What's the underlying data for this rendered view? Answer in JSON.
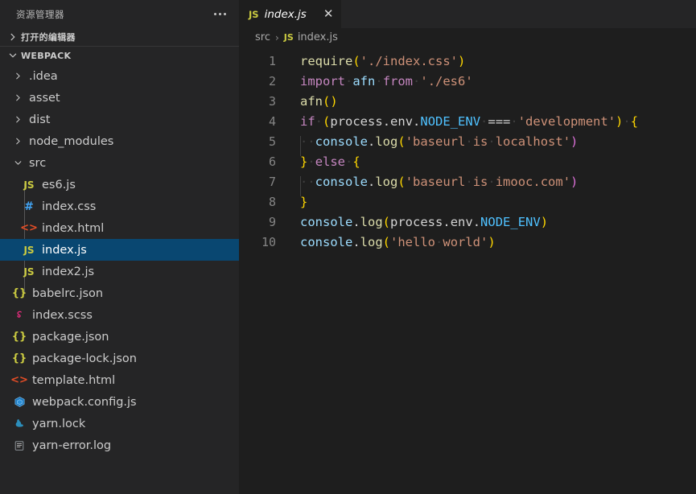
{
  "sidebar": {
    "title": "资源管理器",
    "more_icon": "ellipsis-icon",
    "sections": [
      {
        "label": "打开的编辑器",
        "expanded": false
      },
      {
        "label": "WEBPACK",
        "expanded": true
      }
    ],
    "tree": [
      {
        "label": ".idea",
        "kind": "folder",
        "expanded": false,
        "depth": 1
      },
      {
        "label": "asset",
        "kind": "folder",
        "expanded": false,
        "depth": 1
      },
      {
        "label": "dist",
        "kind": "folder",
        "expanded": false,
        "depth": 1
      },
      {
        "label": "node_modules",
        "kind": "folder",
        "expanded": false,
        "depth": 1
      },
      {
        "label": "src",
        "kind": "folder",
        "expanded": true,
        "depth": 1
      },
      {
        "label": "es6.js",
        "kind": "js",
        "icon": "JS",
        "depth": 2
      },
      {
        "label": "index.css",
        "kind": "css",
        "icon": "#",
        "depth": 2
      },
      {
        "label": "index.html",
        "kind": "html",
        "icon": "<>",
        "depth": 2
      },
      {
        "label": "index.js",
        "kind": "js",
        "icon": "JS",
        "depth": 2,
        "selected": true
      },
      {
        "label": "index2.js",
        "kind": "js",
        "icon": "JS",
        "depth": 2
      },
      {
        "label": "babelrc.json",
        "kind": "json",
        "icon": "{}",
        "depth": 1
      },
      {
        "label": "index.scss",
        "kind": "scss",
        "icon": "S",
        "depth": 1
      },
      {
        "label": "package.json",
        "kind": "json",
        "icon": "{}",
        "depth": 1
      },
      {
        "label": "package-lock.json",
        "kind": "json",
        "icon": "{}",
        "depth": 1
      },
      {
        "label": "template.html",
        "kind": "html",
        "icon": "<>",
        "depth": 1
      },
      {
        "label": "webpack.config.js",
        "kind": "webpack",
        "icon": "cube",
        "depth": 1
      },
      {
        "label": "yarn.lock",
        "kind": "yarn",
        "icon": "yarn",
        "depth": 1
      },
      {
        "label": "yarn-error.log",
        "kind": "log",
        "icon": "log",
        "depth": 1
      }
    ]
  },
  "editor": {
    "tab": {
      "badge": "JS",
      "name": "index.js",
      "close_icon": "close-icon",
      "preview_italic": true
    },
    "breadcrumb": {
      "folder": "src",
      "separator": "›",
      "badge": "JS",
      "file": "index.js"
    },
    "line_numbers": [
      "1",
      "2",
      "3",
      "4",
      "5",
      "6",
      "7",
      "8",
      "9",
      "10"
    ],
    "lines": [
      {
        "n": "1",
        "text": "require('./index.css')"
      },
      {
        "n": "2",
        "text": "import afn from './es6'"
      },
      {
        "n": "3",
        "text": "afn()"
      },
      {
        "n": "4",
        "text": "if (process.env.NODE_ENV === 'development') {"
      },
      {
        "n": "5",
        "text": "  console.log('baseurl is localhost')"
      },
      {
        "n": "6",
        "text": "} else {"
      },
      {
        "n": "7",
        "text": "  console.log('baseurl is imooc.com')"
      },
      {
        "n": "8",
        "text": "}"
      },
      {
        "n": "9",
        "text": "console.log(process.env.NODE_ENV)"
      },
      {
        "n": "10",
        "text": "console.log('hello world')"
      }
    ]
  },
  "colors": {
    "sidebar_bg": "#252526",
    "editor_bg": "#1e1e1e",
    "selection_bg": "#094771",
    "foreground": "#cccccc",
    "line_number": "#858585",
    "keyword": "#c586c0",
    "function": "#dcdcaa",
    "string": "#ce9178",
    "variable": "#9cdcfe",
    "property": "#4fc1ff",
    "bracket_yellow": "#ffd700",
    "bracket_magenta": "#da70d6",
    "js_icon": "#cbcb41",
    "css_icon": "#42a5f5",
    "html_icon": "#e44d26",
    "json_icon": "#cbcb41",
    "scss_icon": "#ff2d88",
    "webpack_icon": "#1c78c0",
    "yarn_icon": "#2c8ebb"
  }
}
